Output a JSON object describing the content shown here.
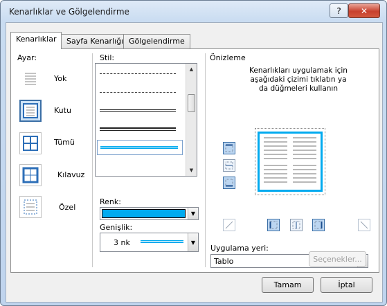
{
  "window": {
    "title": "Kenarlıklar ve Gölgelendirme",
    "help_label": "?",
    "close_label": "✕"
  },
  "tabs": [
    {
      "label": "Kenarlıklar",
      "active": true
    },
    {
      "label": "Sayfa Kenarlığı",
      "active": false
    },
    {
      "label": "Gölgelendirme",
      "active": false
    }
  ],
  "setting": {
    "label": "Ayar:",
    "items": [
      {
        "label": "Yok",
        "icon": "none-border-icon",
        "selected": false
      },
      {
        "label": "Kutu",
        "icon": "box-border-icon",
        "selected": true
      },
      {
        "label": "Tümü",
        "icon": "all-borders-icon",
        "selected": false
      },
      {
        "label": "Kılavuz",
        "icon": "grid-border-icon",
        "selected": false
      },
      {
        "label": "Özel",
        "icon": "custom-border-icon",
        "selected": false
      }
    ]
  },
  "style": {
    "label": "Stil:",
    "lines": [
      "dash-dot",
      "dash-dot-dot",
      "double",
      "thick-thin",
      "thin-thick (selected)"
    ]
  },
  "color": {
    "label": "Renk:",
    "value_color": "#00aaef"
  },
  "width": {
    "label": "Genişlik:",
    "value": "3 nk"
  },
  "preview": {
    "label": "Önizleme",
    "instruction": "Kenarlıkları uygulamak için aşağıdaki çizimi tıklatın ya da düğmeleri kullanın"
  },
  "apply_to": {
    "label": "Uygulama yeri:",
    "value": "Tablo"
  },
  "buttons": {
    "options": "Seçenekler...",
    "ok": "Tamam",
    "cancel": "İptal"
  },
  "colors": {
    "border_accent": "#00aaef",
    "selection": "#cde3f7"
  }
}
